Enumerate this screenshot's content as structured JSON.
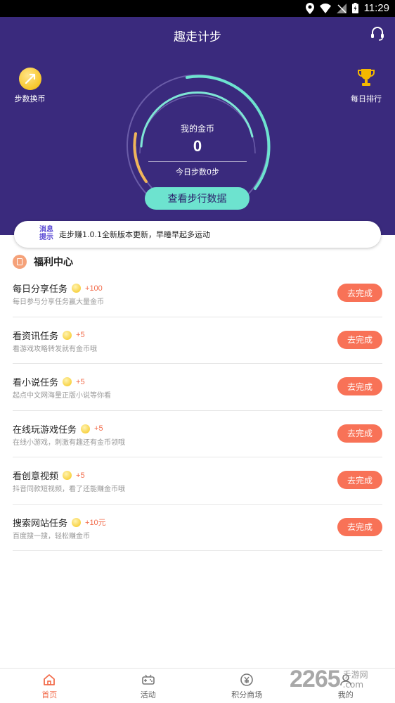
{
  "status_bar": {
    "time": "11:29"
  },
  "header": {
    "title": "趣走计步"
  },
  "hero": {
    "steps_to_coins_label": "步数换币",
    "daily_rank_label": "每日排行",
    "coins_label": "我的金币",
    "coins_value": "0",
    "today_steps": "今日步数0步",
    "view_steps_button": "查看步行数据"
  },
  "notice": {
    "tag": "消息提示",
    "text": "走步赚1.0.1全新版本更新，早睡早起多运动"
  },
  "welfare": {
    "title": "福利中心",
    "tasks": [
      {
        "title": "每日分享任务",
        "reward": "+100",
        "desc": "每日参与分享任务赢大量金币",
        "button": "去完成"
      },
      {
        "title": "看资讯任务",
        "reward": "+5",
        "desc": "看游戏攻略转发就有金币哦",
        "button": "去完成"
      },
      {
        "title": "看小说任务",
        "reward": "+5",
        "desc": "起点中文网海量正版小说等你看",
        "button": "去完成"
      },
      {
        "title": "在线玩游戏任务",
        "reward": "+5",
        "desc": "在线小游戏，刺激有趣还有金币领哦",
        "button": "去完成"
      },
      {
        "title": "看创意视频",
        "reward": "+5",
        "desc": "抖音同款短视频，看了还能赚金币哦",
        "button": "去完成"
      },
      {
        "title": "搜索网站任务",
        "reward": "+10元",
        "desc": "百度搜一搜，轻松赚金币",
        "button": "去完成"
      }
    ]
  },
  "tabbar": {
    "items": [
      {
        "label": "首页",
        "icon": "home-icon"
      },
      {
        "label": "活动",
        "icon": "gamepad-icon"
      },
      {
        "label": "积分商场",
        "icon": "yen-icon"
      },
      {
        "label": "我的",
        "icon": "user-icon"
      }
    ]
  },
  "watermark": {
    "number": "2265",
    "text": "手游网",
    "domain": ".com"
  },
  "colors": {
    "hero_bg": "#3a2a7d",
    "accent": "#f87257",
    "teal": "#6de3cf"
  }
}
